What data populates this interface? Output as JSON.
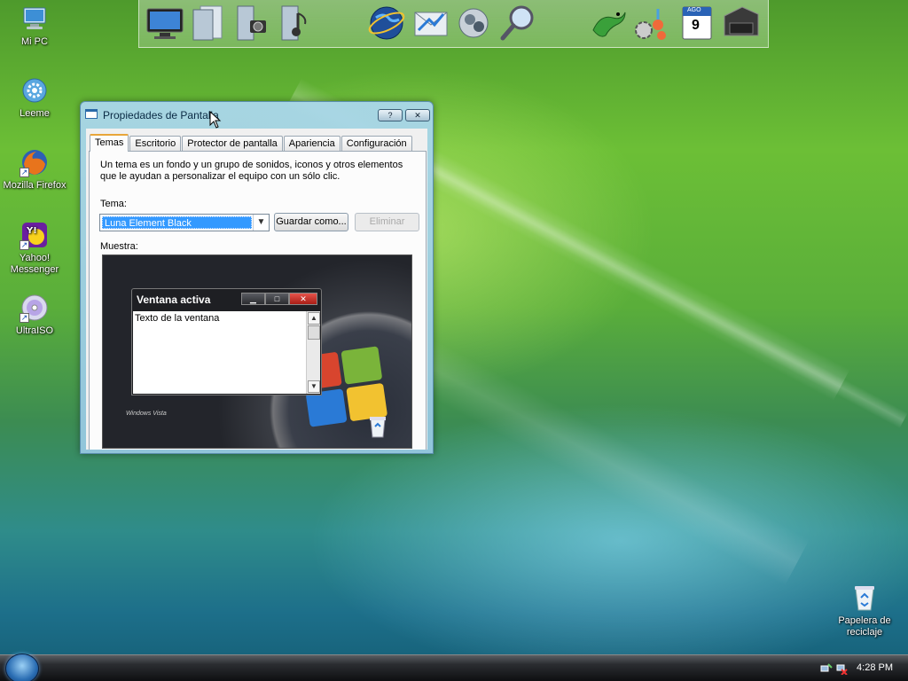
{
  "desktop": {
    "icons": [
      {
        "label": "Mi PC",
        "icon": "computer-icon"
      },
      {
        "label": "Leeme",
        "icon": "gear-icon"
      },
      {
        "label": "Mozilla Firefox",
        "icon": "firefox-icon"
      },
      {
        "label": "Yahoo! Messenger",
        "icon": "yahoo-messenger-icon"
      },
      {
        "label": "UltraISO",
        "icon": "disc-icon"
      },
      {
        "label": "Papelera de reciclaje",
        "icon": "recycle-bin-icon"
      }
    ]
  },
  "dock": {
    "icons": [
      "monitor-icon",
      "documents-icon",
      "pictures-icon",
      "music-icon",
      "globe-icon",
      "mail-icon",
      "messenger-icon",
      "search-icon",
      "gecko-icon",
      "settings-icon",
      "calendar-icon",
      "printer-icon"
    ],
    "calendar_month": "AGO",
    "calendar_day": "9"
  },
  "window": {
    "title": "Propiedades de Pantalla",
    "help_glyph": "?",
    "close_glyph": "✕",
    "tabs": [
      {
        "label": "Temas",
        "active": true
      },
      {
        "label": "Escritorio",
        "active": false
      },
      {
        "label": "Protector de pantalla",
        "active": false
      },
      {
        "label": "Apariencia",
        "active": false
      },
      {
        "label": "Configuración",
        "active": false
      }
    ],
    "description": "Un tema es un fondo y un grupo de sonidos, iconos y otros elementos que le ayudan a personalizar el equipo con un sólo clic.",
    "theme_label": "Tema:",
    "theme_value": "Luna Element Black",
    "save_button": "Guardar como...",
    "delete_button": "Eliminar",
    "sample_label": "Muestra:",
    "preview": {
      "window_title": "Ventana activa",
      "window_text": "Texto de la ventana",
      "brand_text": "Windows Vista"
    }
  },
  "taskbar": {
    "clock": "4:28 PM"
  },
  "colors": {
    "accent_tab": "#e8a63a",
    "selection": "#3399ff",
    "close_red": "#c8302a"
  }
}
